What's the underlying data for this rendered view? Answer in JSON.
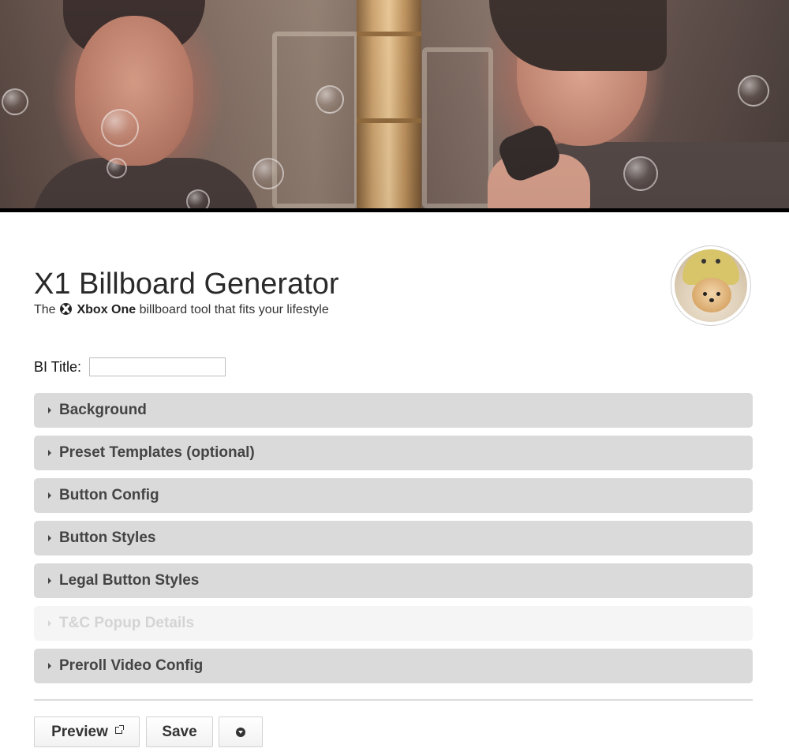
{
  "header": {
    "title": "X1 Billboard Generator",
    "tagline_before": "The ",
    "tagline_brand": "Xbox One",
    "tagline_after": " billboard tool that fits your lifestyle"
  },
  "form": {
    "bi_title_label": "BI Title:",
    "bi_title_value": "",
    "bi_title_placeholder": ""
  },
  "panels": [
    {
      "label": "Background",
      "enabled": true
    },
    {
      "label": "Preset Templates (optional)",
      "enabled": true
    },
    {
      "label": "Button Config",
      "enabled": true
    },
    {
      "label": "Button Styles",
      "enabled": true
    },
    {
      "label": "Legal Button Styles",
      "enabled": true
    },
    {
      "label": "T&C Popup Details",
      "enabled": false
    },
    {
      "label": "Preroll Video Config",
      "enabled": true
    }
  ],
  "actions": {
    "preview_label": "Preview",
    "save_label": "Save"
  },
  "icons": {
    "brand": "xbox-logo-icon",
    "panel_toggle": "caret-right-icon",
    "preview": "external-link-icon",
    "more": "circle-arrow-down-icon"
  },
  "colors": {
    "panel_bg": "#dadada",
    "panel_disabled_bg": "#f5f5f5",
    "panel_text": "#444444",
    "panel_disabled_text": "#d4d4d4",
    "hero_rule": "#000000"
  }
}
